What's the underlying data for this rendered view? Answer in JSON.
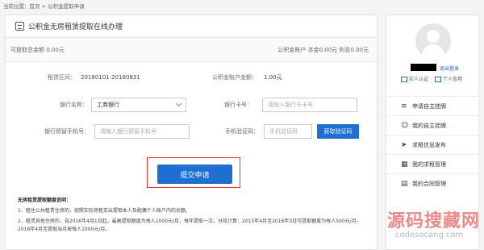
{
  "breadcrumb": "当前位置：首页 > 公积金提取申请",
  "header": {
    "title": "公积金无房租赁提取在线办理"
  },
  "summary": {
    "left": "可提取总金额 0.00元",
    "right": "公积金账户 本金0.00元 利息0.00元"
  },
  "info": {
    "period_label": "租赁区间：",
    "period_value": "20180101-20180831",
    "balance_label": "公积金账户金额：",
    "balance_value": "1.00元"
  },
  "form": {
    "bank_label": "银行名称：",
    "bank_value": "工商银行",
    "card_label": "银行卡号：",
    "card_placeholder": "请输入银行卡卡号",
    "phone_label": "银行预留手机号：",
    "phone_placeholder": "请输入银行预留手机号",
    "code_label": "手机验证码：",
    "code_placeholder": "手机验证码",
    "code_button": "获取验证码",
    "submit": "提交申请"
  },
  "notes": {
    "title": "无房租赁提取额度说明：",
    "items": [
      "1、租住公共租赁住房的，按照实际房租支出提取本人及配偶个人账户内的余额。",
      "2、租赁其他住房的，自2016年4月1日起，最高提取额度为每人1000元/月，每年提取一次，分段计算：2015年4月至2016年3月可提取额度为每人500元/月，2016年4月至提取当月按每人1000元/月。"
    ]
  },
  "sidebar": {
    "logout": "退出登录",
    "badge1": "实人认证",
    "badge2": "个人信用",
    "menu": [
      {
        "icon": "≡",
        "label": "申请自主挂牌"
      },
      {
        "icon": "☺",
        "label": "我的自主挂牌"
      },
      {
        "icon": "➤",
        "label": "求租信息发布"
      },
      {
        "icon": "▦",
        "label": "我的求租管理"
      },
      {
        "icon": "▤",
        "label": "我的合同管理"
      }
    ]
  },
  "watermark": {
    "big": "源码搜藏网",
    "small": "codesocang.com"
  },
  "colors": {
    "primary": "#1e6fd1",
    "highlight": "#ee3333"
  }
}
